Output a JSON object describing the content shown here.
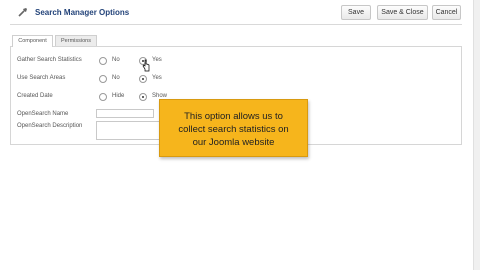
{
  "header": {
    "title": "Search Manager Options",
    "title_icon": "tools-icon",
    "buttons": {
      "save": "Save",
      "save_close": "Save & Close",
      "cancel": "Cancel"
    }
  },
  "tabs": [
    {
      "label": "Component",
      "active": true
    },
    {
      "label": "Permissions",
      "active": false
    }
  ],
  "fields": {
    "gather_search_statistics": {
      "label": "Gather Search Statistics",
      "options": [
        "No",
        "Yes"
      ],
      "selected": "Yes"
    },
    "use_search_areas": {
      "label": "Use Search Areas",
      "options": [
        "No",
        "Yes"
      ],
      "selected": "Yes"
    },
    "created_date": {
      "label": "Created Date",
      "options": [
        "Hide",
        "Show"
      ],
      "selected": "Show"
    },
    "opensearch_name": {
      "label": "OpenSearch Name",
      "value": ""
    },
    "opensearch_description": {
      "label": "OpenSearch Description",
      "value": ""
    }
  },
  "tooltip": {
    "lines": [
      "This option allows us to",
      "collect search statistics on",
      "our Joomla website"
    ]
  },
  "colors": {
    "title": "#24447a",
    "tooltip": "#f6b51c"
  }
}
